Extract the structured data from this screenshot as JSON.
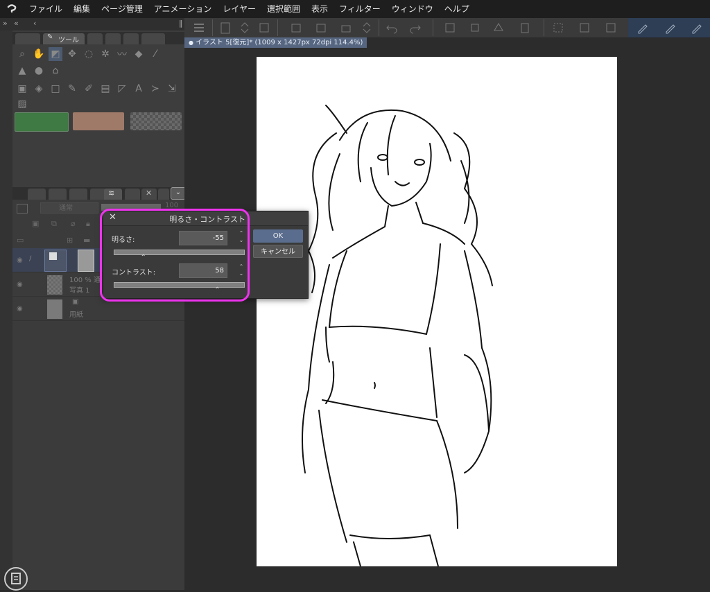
{
  "menu": {
    "items": [
      "ファイル",
      "編集",
      "ページ管理",
      "アニメーション",
      "レイヤー",
      "選択範囲",
      "表示",
      "フィルター",
      "ウィンドウ",
      "ヘルプ"
    ]
  },
  "tool_panel": {
    "tab_label": "ツール"
  },
  "document": {
    "tab_title": "イラスト 5[復元]* (1009 x 1427px 72dpi 114.4%)"
  },
  "layers": {
    "blend_mode": "通常",
    "opacity_partial": "100",
    "rows": [
      {
        "name": "",
        "info": ""
      },
      {
        "name": "写真 1",
        "info": "100 % 通"
      },
      {
        "name": "用紙",
        "info": ""
      }
    ]
  },
  "dialog": {
    "title": "明るさ・コントラスト",
    "close_glyph": "✕",
    "brightness_label": "明るさ:",
    "brightness_value": "-55",
    "brightness_slider_fraction": 0.225,
    "contrast_label": "コントラスト:",
    "contrast_value": "58",
    "contrast_slider_fraction": 0.79,
    "ok_label": "OK",
    "cancel_label": "キャンセル"
  },
  "colors": {
    "main_swatch": "#3f7a44",
    "sub_swatch": "#a07a68",
    "highlight": "#ee33ee",
    "ok_button": "#5a6d8f",
    "doc_tab": "#566680"
  }
}
